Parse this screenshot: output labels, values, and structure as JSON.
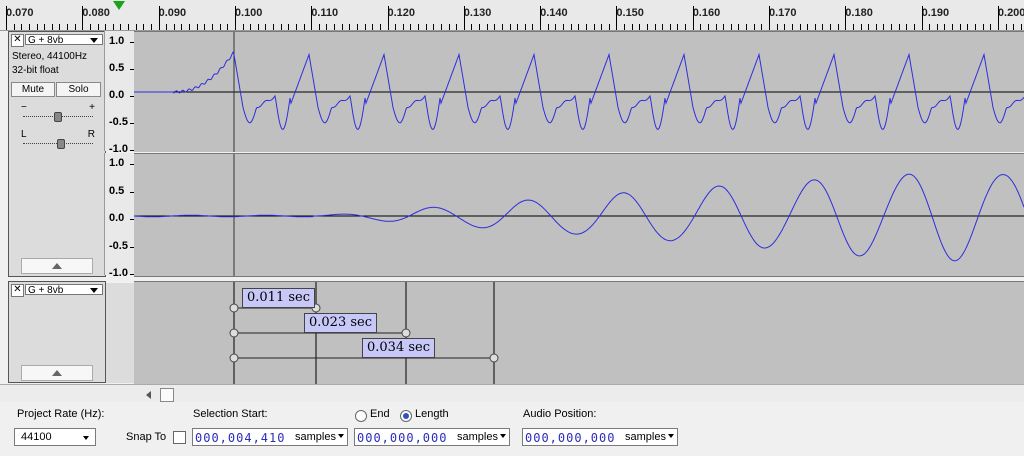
{
  "ruler": {
    "labels": [
      "0.070",
      "0.080",
      "0.090",
      "0.100",
      "0.110",
      "0.120",
      "0.130",
      "0.140",
      "0.150",
      "0.160",
      "0.170",
      "0.180",
      "0.190",
      "0.200"
    ]
  },
  "audio_track": {
    "name": "G + 8vb",
    "format": "Stereo, 44100Hz",
    "bit_depth": "32-bit float",
    "mute_label": "Mute",
    "solo_label": "Solo",
    "gain_minus": "−",
    "gain_plus": "+",
    "pan_left": "L",
    "pan_right": "R",
    "channel_scale": [
      "1.0",
      "0.5",
      "0.0",
      "-0.5",
      "-1.0"
    ]
  },
  "label_track": {
    "name": "G + 8vb",
    "labels": [
      "0.011 sec",
      "0.023 sec",
      "0.034 sec"
    ]
  },
  "bottom": {
    "project_rate_label": "Project Rate (Hz):",
    "project_rate_value": "44100",
    "snap_to_label": "Snap To",
    "selection_start_label": "Selection Start:",
    "selection_start_value": "000,004,410",
    "end_label": "End",
    "length_label": "Length",
    "length_value": "000,000,000",
    "audio_position_label": "Audio Position:",
    "audio_position_value": "000,000,000",
    "unit": "samples"
  },
  "colors": {
    "wave": "#2e2edb",
    "label_fill": "#c7c8f7",
    "track_bg": "#c0c0c0",
    "play_head": "#19a319"
  }
}
